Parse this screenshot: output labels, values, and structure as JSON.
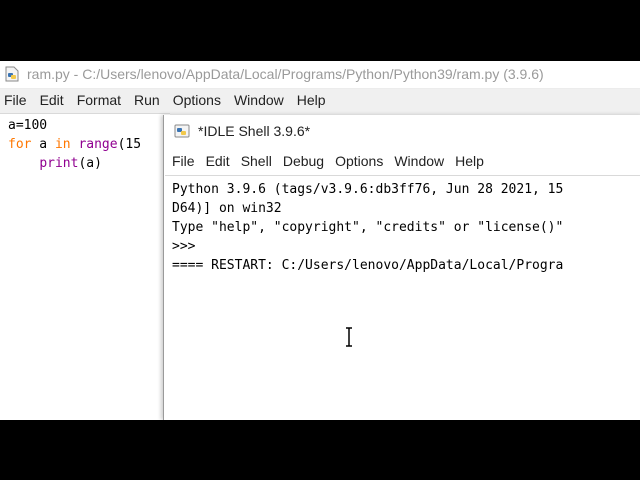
{
  "editor": {
    "title": "ram.py - C:/Users/lenovo/AppData/Local/Programs/Python/Python39/ram.py (3.9.6)",
    "menu": [
      "File",
      "Edit",
      "Format",
      "Run",
      "Options",
      "Window",
      "Help"
    ],
    "code": {
      "line1": "a=100",
      "line2_kw": "for",
      "line2_mid": " a ",
      "line2_kw2": "in",
      "line2_sp": " ",
      "line2_bi": "range",
      "line2_rest": "(15",
      "line3_indent": "    ",
      "line3_bi": "print",
      "line3_rest": "(a)"
    }
  },
  "shell": {
    "title": "*IDLE Shell 3.9.6*",
    "menu": [
      "File",
      "Edit",
      "Shell",
      "Debug",
      "Options",
      "Window",
      "Help"
    ],
    "output": {
      "line1": "Python 3.9.6 (tags/v3.9.6:db3ff76, Jun 28 2021, 15",
      "line2": "D64)] on win32",
      "line3": "Type \"help\", \"copyright\", \"credits\" or \"license()\"",
      "prompt": ">>>",
      "restart": "==== RESTART: C:/Users/lenovo/AppData/Local/Progra"
    }
  },
  "icons": {
    "window_icon": "python-idle-icon",
    "cursor": "text-cursor-icon"
  }
}
